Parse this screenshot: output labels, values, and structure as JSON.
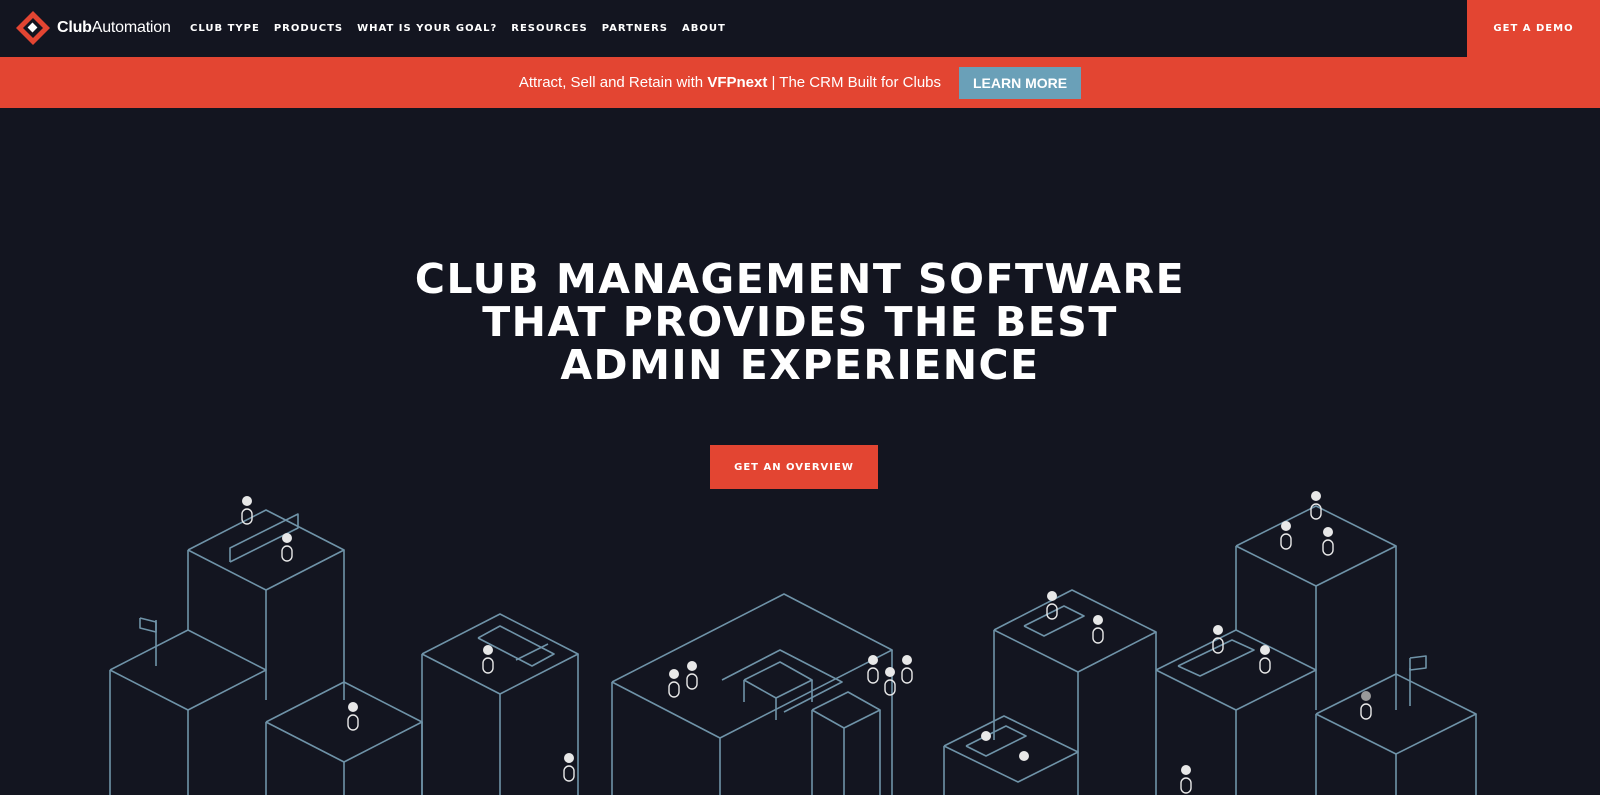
{
  "nav": {
    "logo_bold": "Club",
    "logo_light": "Automation",
    "menu": [
      "CLUB TYPE",
      "PRODUCTS",
      "WHAT IS YOUR GOAL?",
      "RESOURCES",
      "PARTNERS",
      "ABOUT"
    ],
    "cta": "GET A DEMO"
  },
  "banner": {
    "text_prefix": "Attract, Sell and Retain with ",
    "text_bold": "VFPnext",
    "text_suffix": " | The CRM Built for Clubs",
    "button": "LEARN MORE"
  },
  "hero": {
    "title_lines": [
      "CLUB MANAGEMENT SOFTWARE",
      "THAT PROVIDES THE BEST",
      "ADMIN EXPERIENCE"
    ],
    "cta": "GET AN OVERVIEW"
  },
  "colors": {
    "background": "#131520",
    "accent": "#e34532",
    "learn_button": "#6aa0b8",
    "illustration_line": "#6f93a8"
  }
}
